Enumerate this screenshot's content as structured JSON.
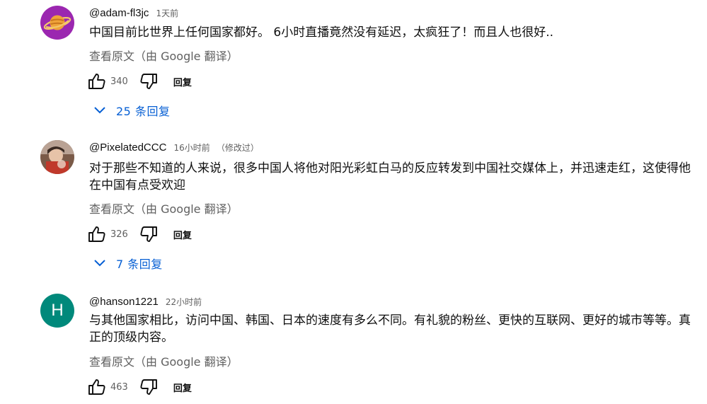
{
  "comments": [
    {
      "author": "@adam-fl3jc",
      "time": "1天前",
      "edited": "",
      "text": "中国目前比世界上任何国家都好。 6小时直播竟然没有延迟，太疯狂了！而且人也很好..",
      "translate_label": "查看原文（由 Google 翻译）",
      "likes": "340",
      "reply_label": "回复",
      "replies_label": "25 条回复",
      "avatar": "planet-avatar"
    },
    {
      "author": "@PixelatedCCC",
      "time": "16小时前",
      "edited": "（修改过）",
      "text": "对于那些不知道的人来说，很多中国人将他对阳光彩虹白马的反应转发到中国社交媒体上，并迅速走红，这使得他在中国有点受欢迎",
      "translate_label": "查看原文（由 Google 翻译）",
      "likes": "326",
      "reply_label": "回复",
      "replies_label": "7 条回复",
      "avatar": "photo-avatar"
    },
    {
      "author": "@hanson1221",
      "time": "22小时前",
      "edited": "",
      "text": "与其他国家相比，访问中国、韩国、日本的速度有多么不同。有礼貌的粉丝、更快的互联网、更好的城市等等。真正的顶级内容。",
      "translate_label": "查看原文（由 Google 翻译）",
      "likes": "463",
      "reply_label": "回复",
      "avatar_letter": "H",
      "avatar": "letter-avatar"
    }
  ],
  "icons": {
    "like": "thumb-up-icon",
    "dislike": "thumb-down-icon",
    "expand": "chevron-down-icon"
  },
  "colors": {
    "link_blue": "#065fd4",
    "secondary_text": "#606060",
    "letter_avatar_bg": "#00897b",
    "planet_avatar_bg": "#9b27b0"
  }
}
